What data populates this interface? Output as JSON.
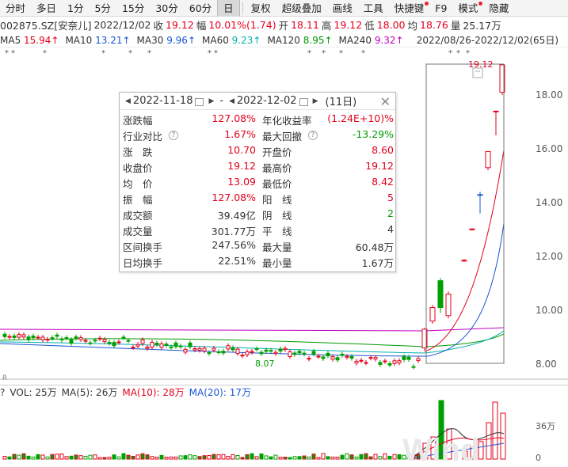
{
  "toolbar": {
    "items": [
      "分时",
      "多日",
      "1分",
      "5分",
      "15分",
      "30分",
      "60分",
      "日",
      "复权",
      "超级叠加",
      "画线",
      "工具",
      "快捷键",
      "F9",
      "模式",
      "隐藏"
    ]
  },
  "quote": {
    "code_name": "002875.SZ[安奈儿]",
    "date": "2022/12/02",
    "close_label": "收",
    "close": "19.12",
    "change_label": "幅",
    "change": "10.01%(1.74)",
    "open_label": "开",
    "open": "18.11",
    "high_label": "高",
    "high": "19.12",
    "low_label": "低",
    "low": "18.00",
    "avg_label": "均",
    "avg": "18.76",
    "volume_label": "量",
    "volume": "25.17万"
  },
  "ma": {
    "items": [
      {
        "label": "MA5",
        "value": "15.94↑",
        "color": "#e3001b"
      },
      {
        "label": "MA10",
        "value": "13.21↑",
        "color": "#1a56d6"
      },
      {
        "label": "MA30",
        "value": "9.96↑",
        "color": "#1a56d6"
      },
      {
        "label": "MA60",
        "value": "9.23↑",
        "color": "#00b0b0"
      },
      {
        "label": "MA120",
        "value": "8.95↑",
        "color": "#009a00"
      },
      {
        "label": "MA240",
        "value": "9.32↑",
        "color": "#c000c0"
      }
    ],
    "range": "2022/08/26-2022/12/02(65日)"
  },
  "chart": {
    "axis_labels": [
      "18.00",
      "16.00",
      "14.00",
      "12.00",
      "10.00",
      "8.00"
    ],
    "high_label": "19.12",
    "low_label": "8.07",
    "volume_axis": [
      "36万",
      "0"
    ],
    "colors": {
      "up": "#e3001b",
      "down": "#00a000"
    }
  },
  "popup": {
    "start_date": "2022-11-18",
    "end_date": "2022-12-02",
    "days": "(11日)",
    "dash": "-",
    "rows": [
      {
        "l1": "涨跌幅",
        "v1": "127.08%",
        "l2": "年化收益率",
        "v2": "(1.24E+10)%",
        "c1": "red",
        "c2": "red"
      },
      {
        "l1": "行业对比",
        "v1": "1.67%",
        "l2": "最大回撤",
        "v2": "-13.29%",
        "c1": "red",
        "c2": "green"
      },
      {
        "l1": "涨　跌",
        "v1": "10.70",
        "l2": "开盘价",
        "v2": "8.60",
        "c1": "red",
        "c2": "red"
      },
      {
        "l1": "收盘价",
        "v1": "19.12",
        "l2": "最高价",
        "v2": "19.12",
        "c1": "red",
        "c2": "red"
      },
      {
        "l1": "均　价",
        "v1": "13.09",
        "l2": "最低价",
        "v2": "8.42",
        "c1": "red",
        "c2": "red"
      },
      {
        "l1": "振　幅",
        "v1": "127.08%",
        "l2": "阳　线",
        "v2": "5",
        "c1": "red",
        "c2": "red"
      },
      {
        "l1": "成交额",
        "v1": "39.49亿",
        "l2": "阴　线",
        "v2": "2",
        "c1": "black",
        "c2": "green"
      },
      {
        "l1": "成交量",
        "v1": "301.77万",
        "l2": "平　线",
        "v2": "4",
        "c1": "black",
        "c2": "black"
      },
      {
        "l1": "区间换手",
        "v1": "247.56%",
        "l2": "最大量",
        "v2": "60.48万",
        "c1": "black",
        "c2": "black"
      },
      {
        "l1": "日均换手",
        "v1": "22.51%",
        "l2": "最小量",
        "v2": "1.67万",
        "c1": "black",
        "c2": "black"
      }
    ]
  },
  "volume": {
    "qmark": "?",
    "vol": "VOL: 25万",
    "ma5": "MA(5): 26万",
    "ma10": "MA(10): 28万",
    "ma20": "MA(20): 17万"
  },
  "watermark": "Wind"
}
